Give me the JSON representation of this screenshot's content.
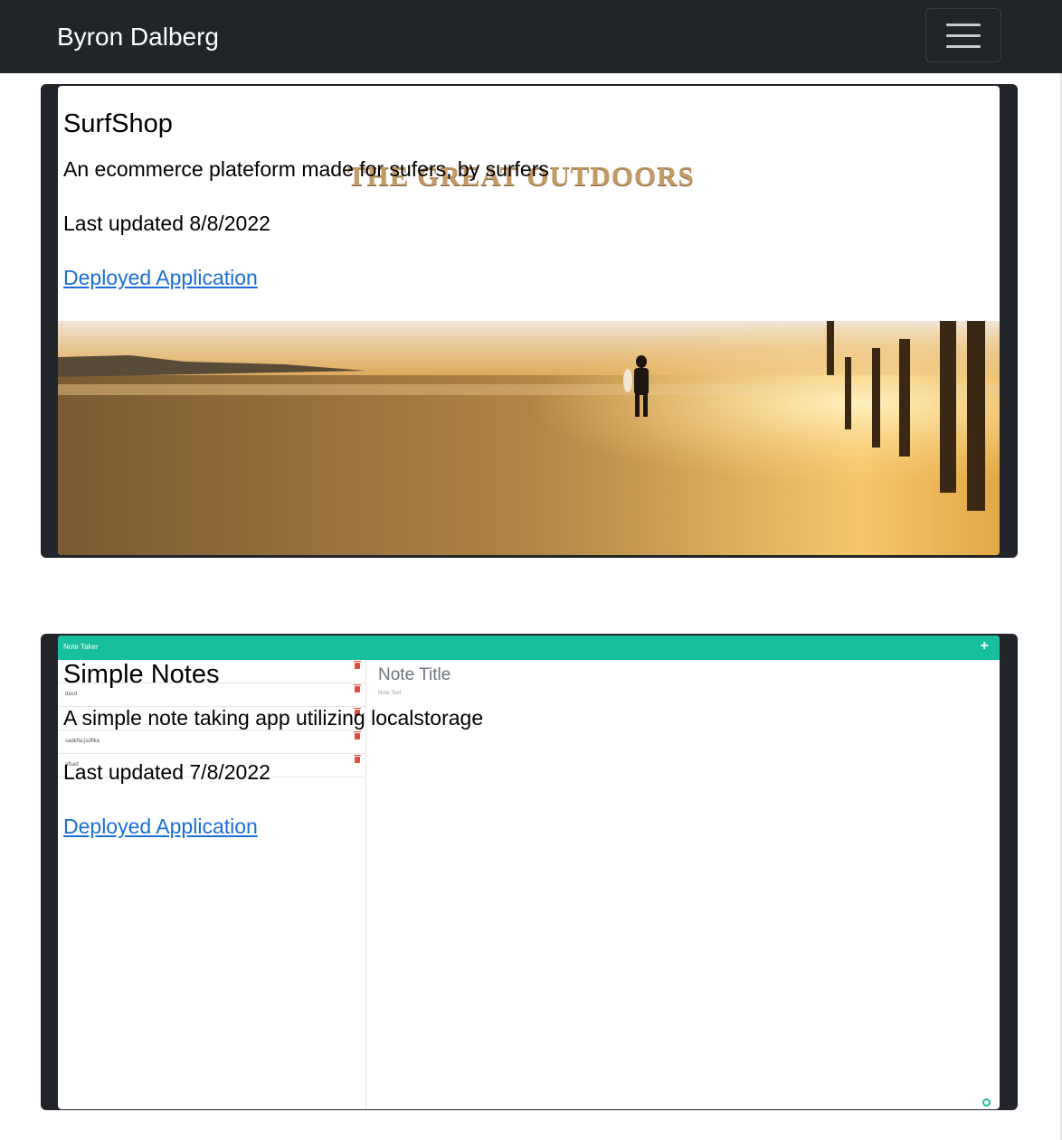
{
  "navbar": {
    "brand": "Byron Dalberg",
    "toggle_icon": "hamburger-menu-icon"
  },
  "projects": [
    {
      "title": "SurfShop",
      "description": "An ecommerce plateform made for sufers, by surfers",
      "updated": "Last updated 8/8/2022",
      "link_label": "Deployed Application",
      "screenshot": {
        "logo_text": "THE GREAT OUTDOORS"
      }
    },
    {
      "title": "Simple Notes",
      "description": "A simple note taking app utilizing localstorage",
      "updated": "Last updated 7/8/2022",
      "link_label": "Deployed Application",
      "screenshot": {
        "app_title": "Note Taker",
        "add_symbol": "+",
        "note_title_placeholder": "Note Title",
        "note_text_placeholder": "Note Text",
        "notes": [
          "",
          "dasd",
          "",
          "sadkfta;jsdflka",
          "afsad"
        ],
        "accent_color": "#17bf9e"
      }
    }
  ],
  "colors": {
    "navbar_bg": "#212529",
    "card_bg": "#212529",
    "link": "#1a6fd8"
  }
}
